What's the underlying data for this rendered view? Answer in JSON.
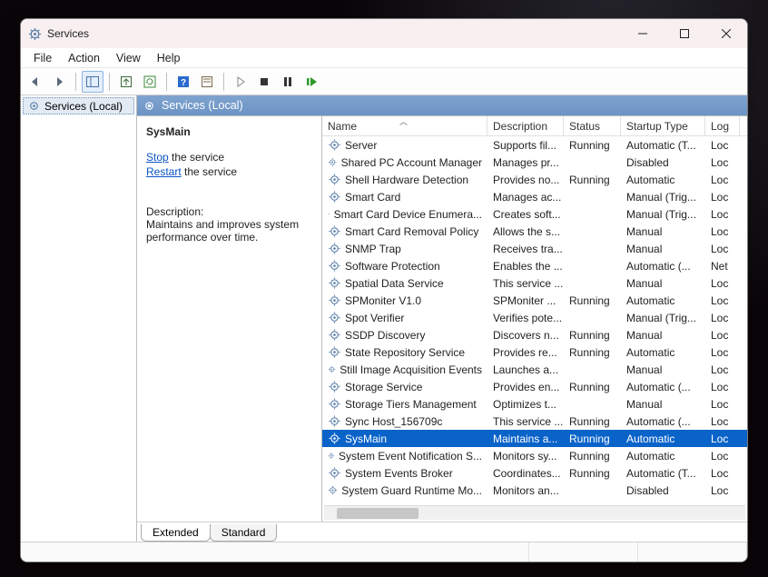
{
  "window": {
    "title": "Services"
  },
  "menu": {
    "file": "File",
    "action": "Action",
    "view": "View",
    "help": "Help"
  },
  "tree": {
    "root": "Services (Local)"
  },
  "main": {
    "header": "Services (Local)"
  },
  "details": {
    "service_name": "SysMain",
    "stop_link": "Stop",
    "stop_suffix": " the service",
    "restart_link": "Restart",
    "restart_suffix": " the service",
    "description_label": "Description:",
    "description_text": "Maintains and improves system performance over time."
  },
  "columns": {
    "name": "Name",
    "description": "Description",
    "status": "Status",
    "startup": "Startup Type",
    "logon": "Log"
  },
  "tabs": {
    "extended": "Extended",
    "standard": "Standard"
  },
  "rows": [
    {
      "name": "Server",
      "desc": "Supports fil...",
      "status": "Running",
      "startup": "Automatic (T...",
      "logon": "Loc"
    },
    {
      "name": "Shared PC Account Manager",
      "desc": "Manages pr...",
      "status": "",
      "startup": "Disabled",
      "logon": "Loc"
    },
    {
      "name": "Shell Hardware Detection",
      "desc": "Provides no...",
      "status": "Running",
      "startup": "Automatic",
      "logon": "Loc"
    },
    {
      "name": "Smart Card",
      "desc": "Manages ac...",
      "status": "",
      "startup": "Manual (Trig...",
      "logon": "Loc"
    },
    {
      "name": "Smart Card Device Enumera...",
      "desc": "Creates soft...",
      "status": "",
      "startup": "Manual (Trig...",
      "logon": "Loc"
    },
    {
      "name": "Smart Card Removal Policy",
      "desc": "Allows the s...",
      "status": "",
      "startup": "Manual",
      "logon": "Loc"
    },
    {
      "name": "SNMP Trap",
      "desc": "Receives tra...",
      "status": "",
      "startup": "Manual",
      "logon": "Loc"
    },
    {
      "name": "Software Protection",
      "desc": "Enables the ...",
      "status": "",
      "startup": "Automatic (...",
      "logon": "Net"
    },
    {
      "name": "Spatial Data Service",
      "desc": "This service ...",
      "status": "",
      "startup": "Manual",
      "logon": "Loc"
    },
    {
      "name": "SPMoniter V1.0",
      "desc": "SPMoniter ...",
      "status": "Running",
      "startup": "Automatic",
      "logon": "Loc"
    },
    {
      "name": "Spot Verifier",
      "desc": "Verifies pote...",
      "status": "",
      "startup": "Manual (Trig...",
      "logon": "Loc"
    },
    {
      "name": "SSDP Discovery",
      "desc": "Discovers n...",
      "status": "Running",
      "startup": "Manual",
      "logon": "Loc"
    },
    {
      "name": "State Repository Service",
      "desc": "Provides re...",
      "status": "Running",
      "startup": "Automatic",
      "logon": "Loc"
    },
    {
      "name": "Still Image Acquisition Events",
      "desc": "Launches a...",
      "status": "",
      "startup": "Manual",
      "logon": "Loc"
    },
    {
      "name": "Storage Service",
      "desc": "Provides en...",
      "status": "Running",
      "startup": "Automatic (...",
      "logon": "Loc"
    },
    {
      "name": "Storage Tiers Management",
      "desc": "Optimizes t...",
      "status": "",
      "startup": "Manual",
      "logon": "Loc"
    },
    {
      "name": "Sync Host_156709c",
      "desc": "This service ...",
      "status": "Running",
      "startup": "Automatic (...",
      "logon": "Loc"
    },
    {
      "name": "SysMain",
      "desc": "Maintains a...",
      "status": "Running",
      "startup": "Automatic",
      "logon": "Loc",
      "selected": true
    },
    {
      "name": "System Event Notification S...",
      "desc": "Monitors sy...",
      "status": "Running",
      "startup": "Automatic",
      "logon": "Loc"
    },
    {
      "name": "System Events Broker",
      "desc": "Coordinates...",
      "status": "Running",
      "startup": "Automatic (T...",
      "logon": "Loc"
    },
    {
      "name": "System Guard Runtime Mo...",
      "desc": "Monitors an...",
      "status": "",
      "startup": "Disabled",
      "logon": "Loc"
    }
  ]
}
